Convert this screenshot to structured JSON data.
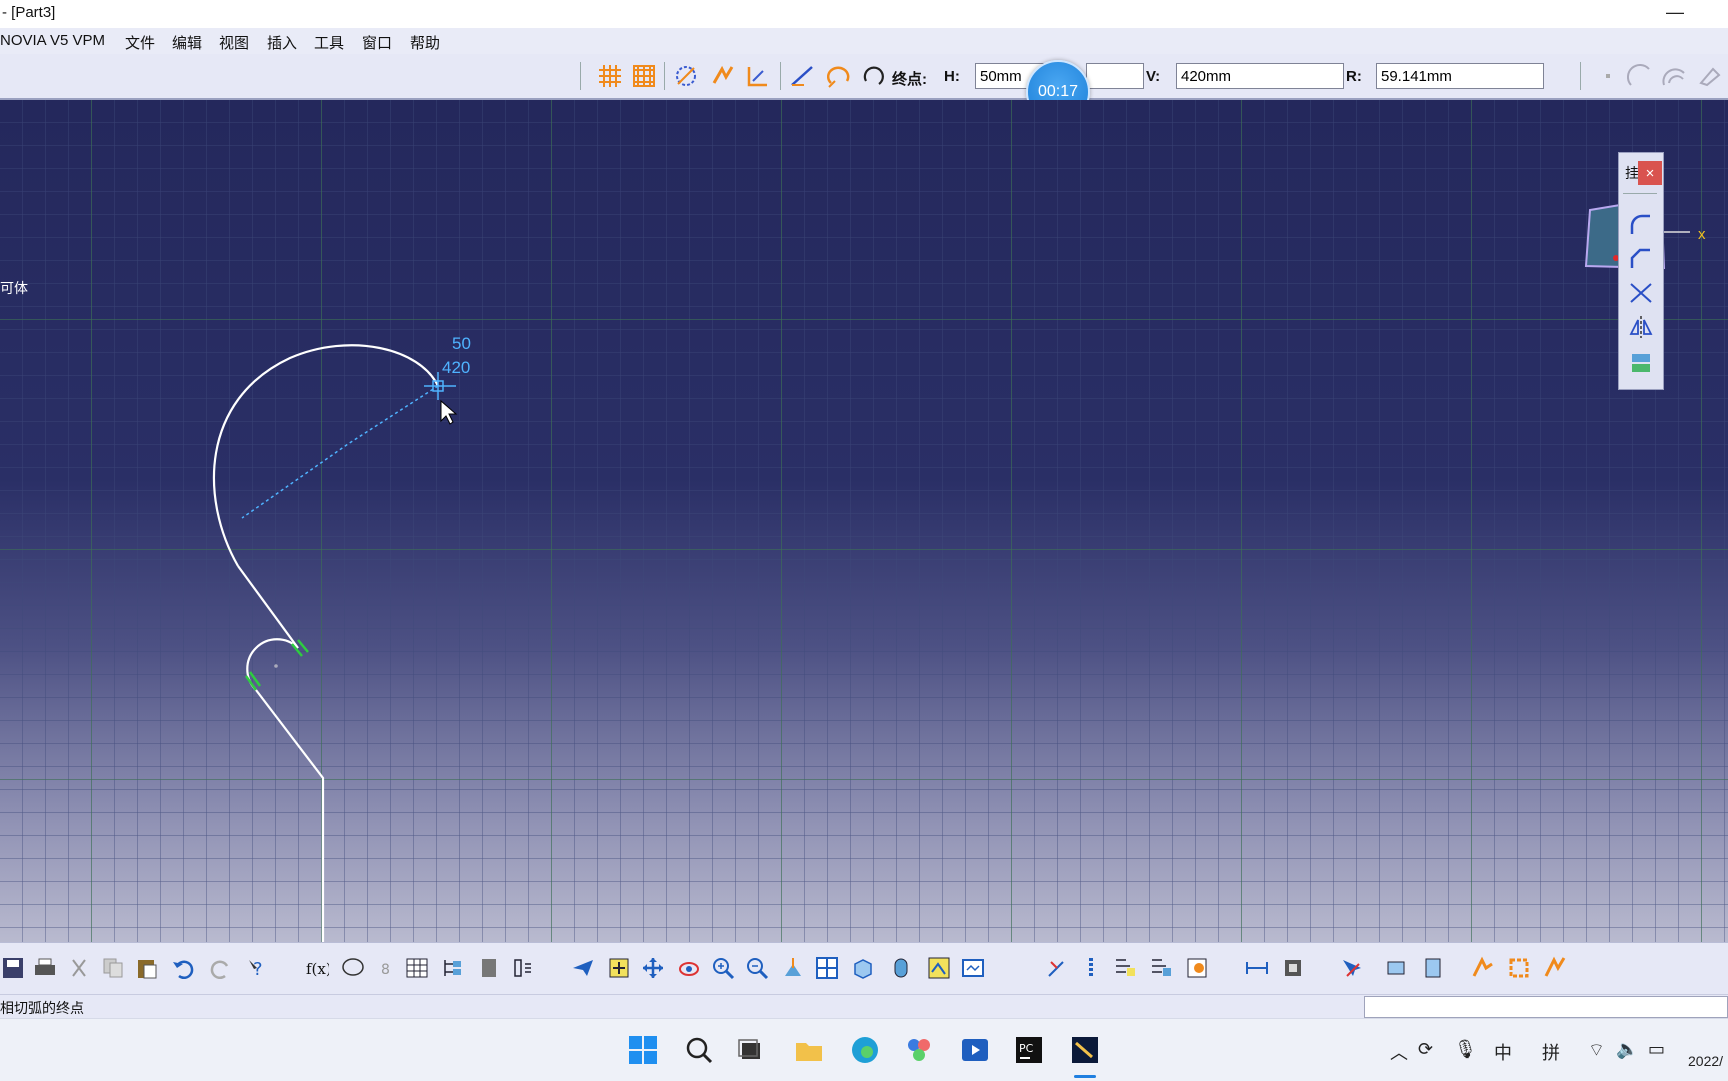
{
  "window": {
    "title": "- [Part3]",
    "minimize_glyph": "—"
  },
  "menu": [
    "NOVIA V5 VPM",
    "文件",
    "编辑",
    "视图",
    "插入",
    "工具",
    "窗口",
    "帮助"
  ],
  "sketch_tools": {
    "endpoint_label": "终点:",
    "h_label": "H:",
    "h_value": "50mm",
    "v_label": "V:",
    "v_value": "420mm",
    "r_label": "R:",
    "r_value": "59.141mm"
  },
  "timer": "00:17",
  "canvas": {
    "tree_label": "可体",
    "cursor_h": "50",
    "cursor_v": "420",
    "axis_label": "x"
  },
  "palette": {
    "title": "挂",
    "close": "×"
  },
  "status": {
    "message": "相切弧的终点"
  },
  "taskbar": {
    "ime_zh": "中",
    "ime_pin": "拼",
    "date": "2022/"
  },
  "colors": {
    "canvas_top": "#24285c",
    "canvas_bottom": "#b9bacf",
    "sketch_line": "#ffffff",
    "dimension": "#4fb3ff",
    "constraint": "#2ecc40",
    "accent_orange": "#f08a1c"
  }
}
